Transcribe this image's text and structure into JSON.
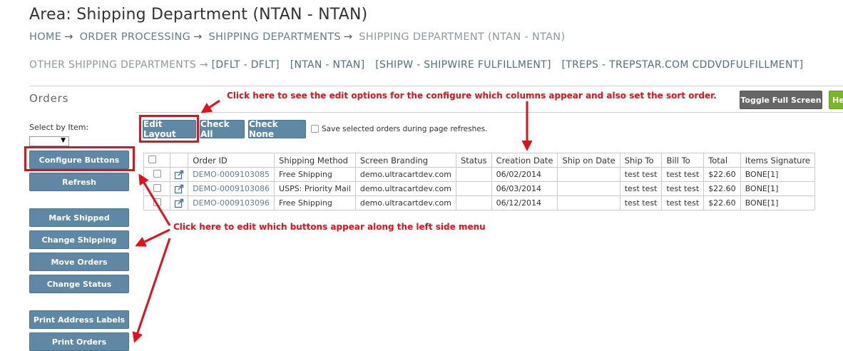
{
  "page": {
    "title": "Area: Shipping Department (NTAN - NTAN)",
    "breadcrumb": [
      {
        "label": "HOME"
      },
      {
        "label": "ORDER PROCESSING"
      },
      {
        "label": "SHIPPING DEPARTMENTS"
      },
      {
        "label": "SHIPPING DEPARTMENT (NTAN - NTAN)"
      }
    ],
    "arrow": "→",
    "other_departments": {
      "label": "OTHER SHIPPING DEPARTMENTS →",
      "links": [
        "[DFLT - DFLT]",
        "[NTAN - NTAN]",
        "[SHIPW - SHIPWIRE FULFILLMENT]",
        "[TREPS - TREPSTAR.COM CDDVDFULFILLMENT]"
      ]
    }
  },
  "orders": {
    "section_title": "Orders",
    "toggle_full_screen": "Toggle Full Screen",
    "help_button": "He",
    "select_by_item_label": "Select by Item:",
    "select_arrow": "▼",
    "toolbar": {
      "edit_layout": "Edit Layout",
      "check_all": "Check All",
      "check_none": "Check None",
      "save_selected": "Save selected orders during page refreshes."
    },
    "sidebar": {
      "configure_buttons": "Configure Buttons",
      "refresh": "Refresh",
      "mark_shipped": "Mark Shipped",
      "change_shipping": "Change Shipping",
      "move_orders": "Move Orders",
      "change_status": "Change Status",
      "print_address_labels": "Print Address Labels",
      "print_orders": "Print Orders"
    },
    "table": {
      "columns": [
        "Order ID",
        "Shipping Method",
        "Screen Branding",
        "Status",
        "Creation Date",
        "Ship on Date",
        "Ship To",
        "Bill To",
        "Total",
        "Items Signature"
      ],
      "rows": [
        {
          "order_id": "DEMO-0009103085",
          "shipping_method": "Free Shipping",
          "screen_branding": "demo.ultracartdev.com",
          "status": "",
          "creation_date": "06/02/2014",
          "ship_on_date": "",
          "ship_to": "test test",
          "bill_to": "test test",
          "total": "$22.60",
          "items_signature": "BONE[1]"
        },
        {
          "order_id": "DEMO-0009103086",
          "shipping_method": "USPS: Priority Mail",
          "screen_branding": "demo.ultracartdev.com",
          "status": "",
          "creation_date": "06/03/2014",
          "ship_on_date": "",
          "ship_to": "test test",
          "bill_to": "test test",
          "total": "$22.60",
          "items_signature": "BONE[1]"
        },
        {
          "order_id": "DEMO-0009103096",
          "shipping_method": "Free Shipping",
          "screen_branding": "demo.ultracartdev.com",
          "status": "",
          "creation_date": "06/12/2014",
          "ship_on_date": "",
          "ship_to": "test test",
          "bill_to": "test test",
          "total": "$22.60",
          "items_signature": "BONE[1]"
        }
      ]
    }
  },
  "annotations": {
    "edit_layout_note": "Click here to see the edit options for the configure which columns appear and also set the sort order.",
    "buttons_note": "Click here to edit which buttons appear along the left side menu"
  },
  "colors": {
    "button": "#5f88a5",
    "annotation": "#e3101b",
    "link": "#5f7f96",
    "help_button": "#7bb52a"
  },
  "icons": {
    "external_link": "external-link-icon"
  }
}
